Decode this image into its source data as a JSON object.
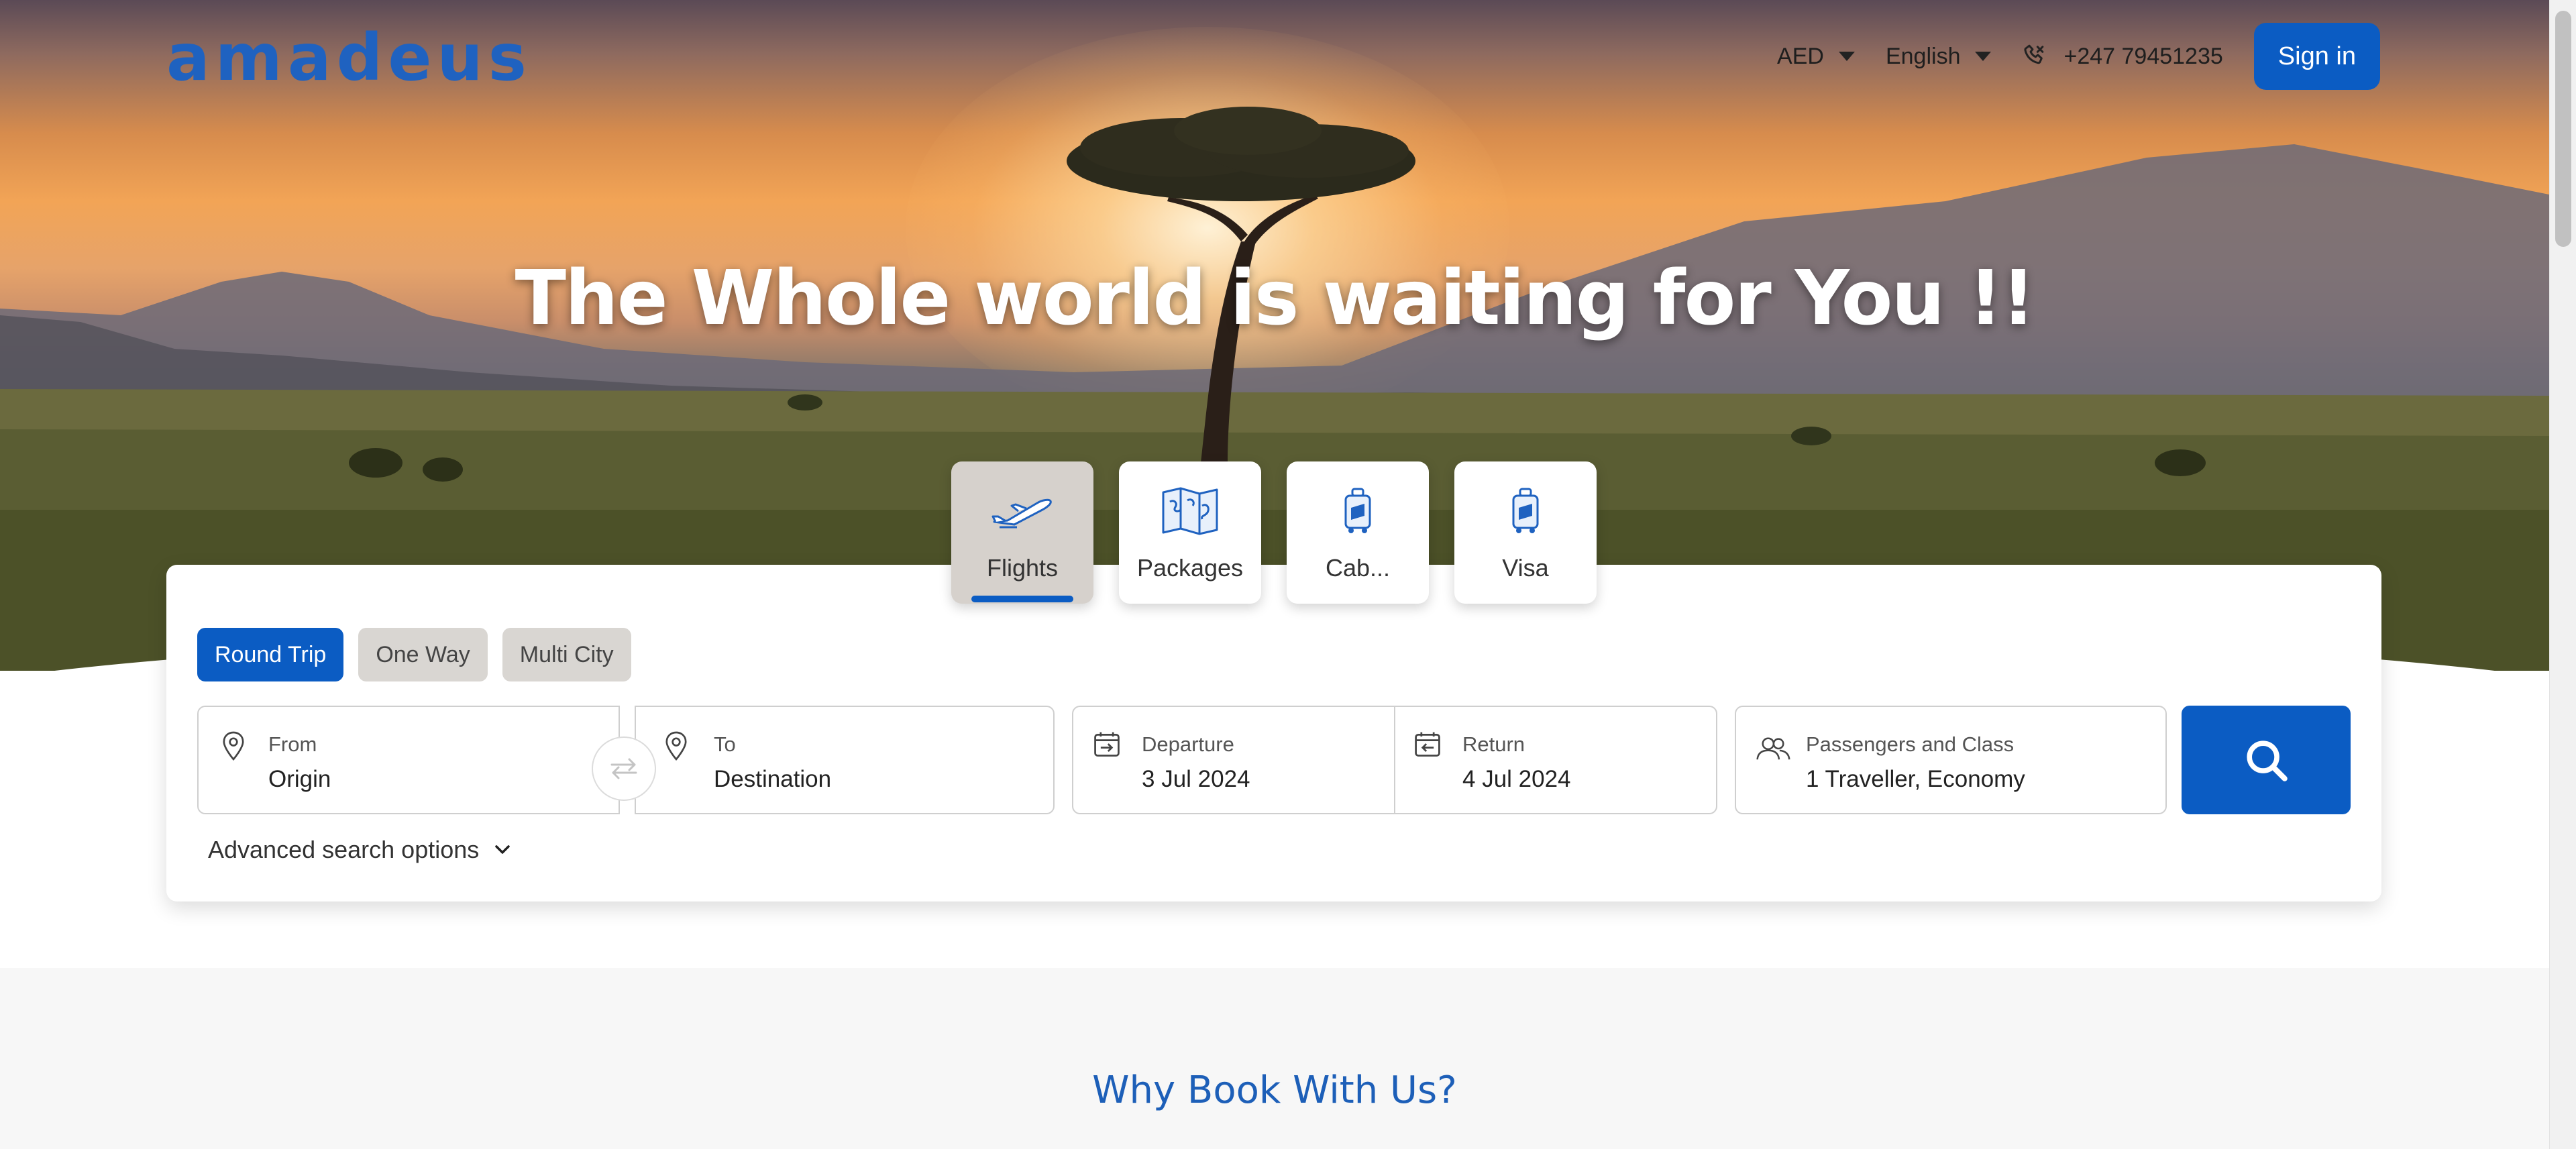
{
  "header": {
    "logo": "amadeus",
    "currency": "AED",
    "language": "English",
    "phone": "+247 79451235",
    "sign_in": "Sign in"
  },
  "hero": {
    "title": "The Whole world is waiting for You !!"
  },
  "categories": [
    {
      "label": "Flights",
      "icon": "airplane-icon",
      "active": true
    },
    {
      "label": "Packages",
      "icon": "map-icon",
      "active": false
    },
    {
      "label": "Cab...",
      "icon": "luggage-icon",
      "active": false
    },
    {
      "label": "Visa",
      "icon": "luggage-icon",
      "active": false
    }
  ],
  "search": {
    "trip_types": [
      "Round Trip",
      "One Way",
      "Multi City"
    ],
    "selected_trip_type": "Round Trip",
    "from": {
      "label": "From",
      "value": "Origin"
    },
    "to": {
      "label": "To",
      "value": "Destination"
    },
    "departure": {
      "label": "Departure",
      "value": "3 Jul 2024"
    },
    "return": {
      "label": "Return",
      "value": "4 Jul 2024"
    },
    "passengers": {
      "label": "Passengers and Class",
      "value": "1 Traveller, Economy"
    },
    "advanced": "Advanced search options"
  },
  "section": {
    "why_title": "Why Book With Us?"
  },
  "colors": {
    "brand": "#0b5cc3",
    "logo": "#1f62c0",
    "active_tab_bg": "#d6d1cc"
  }
}
